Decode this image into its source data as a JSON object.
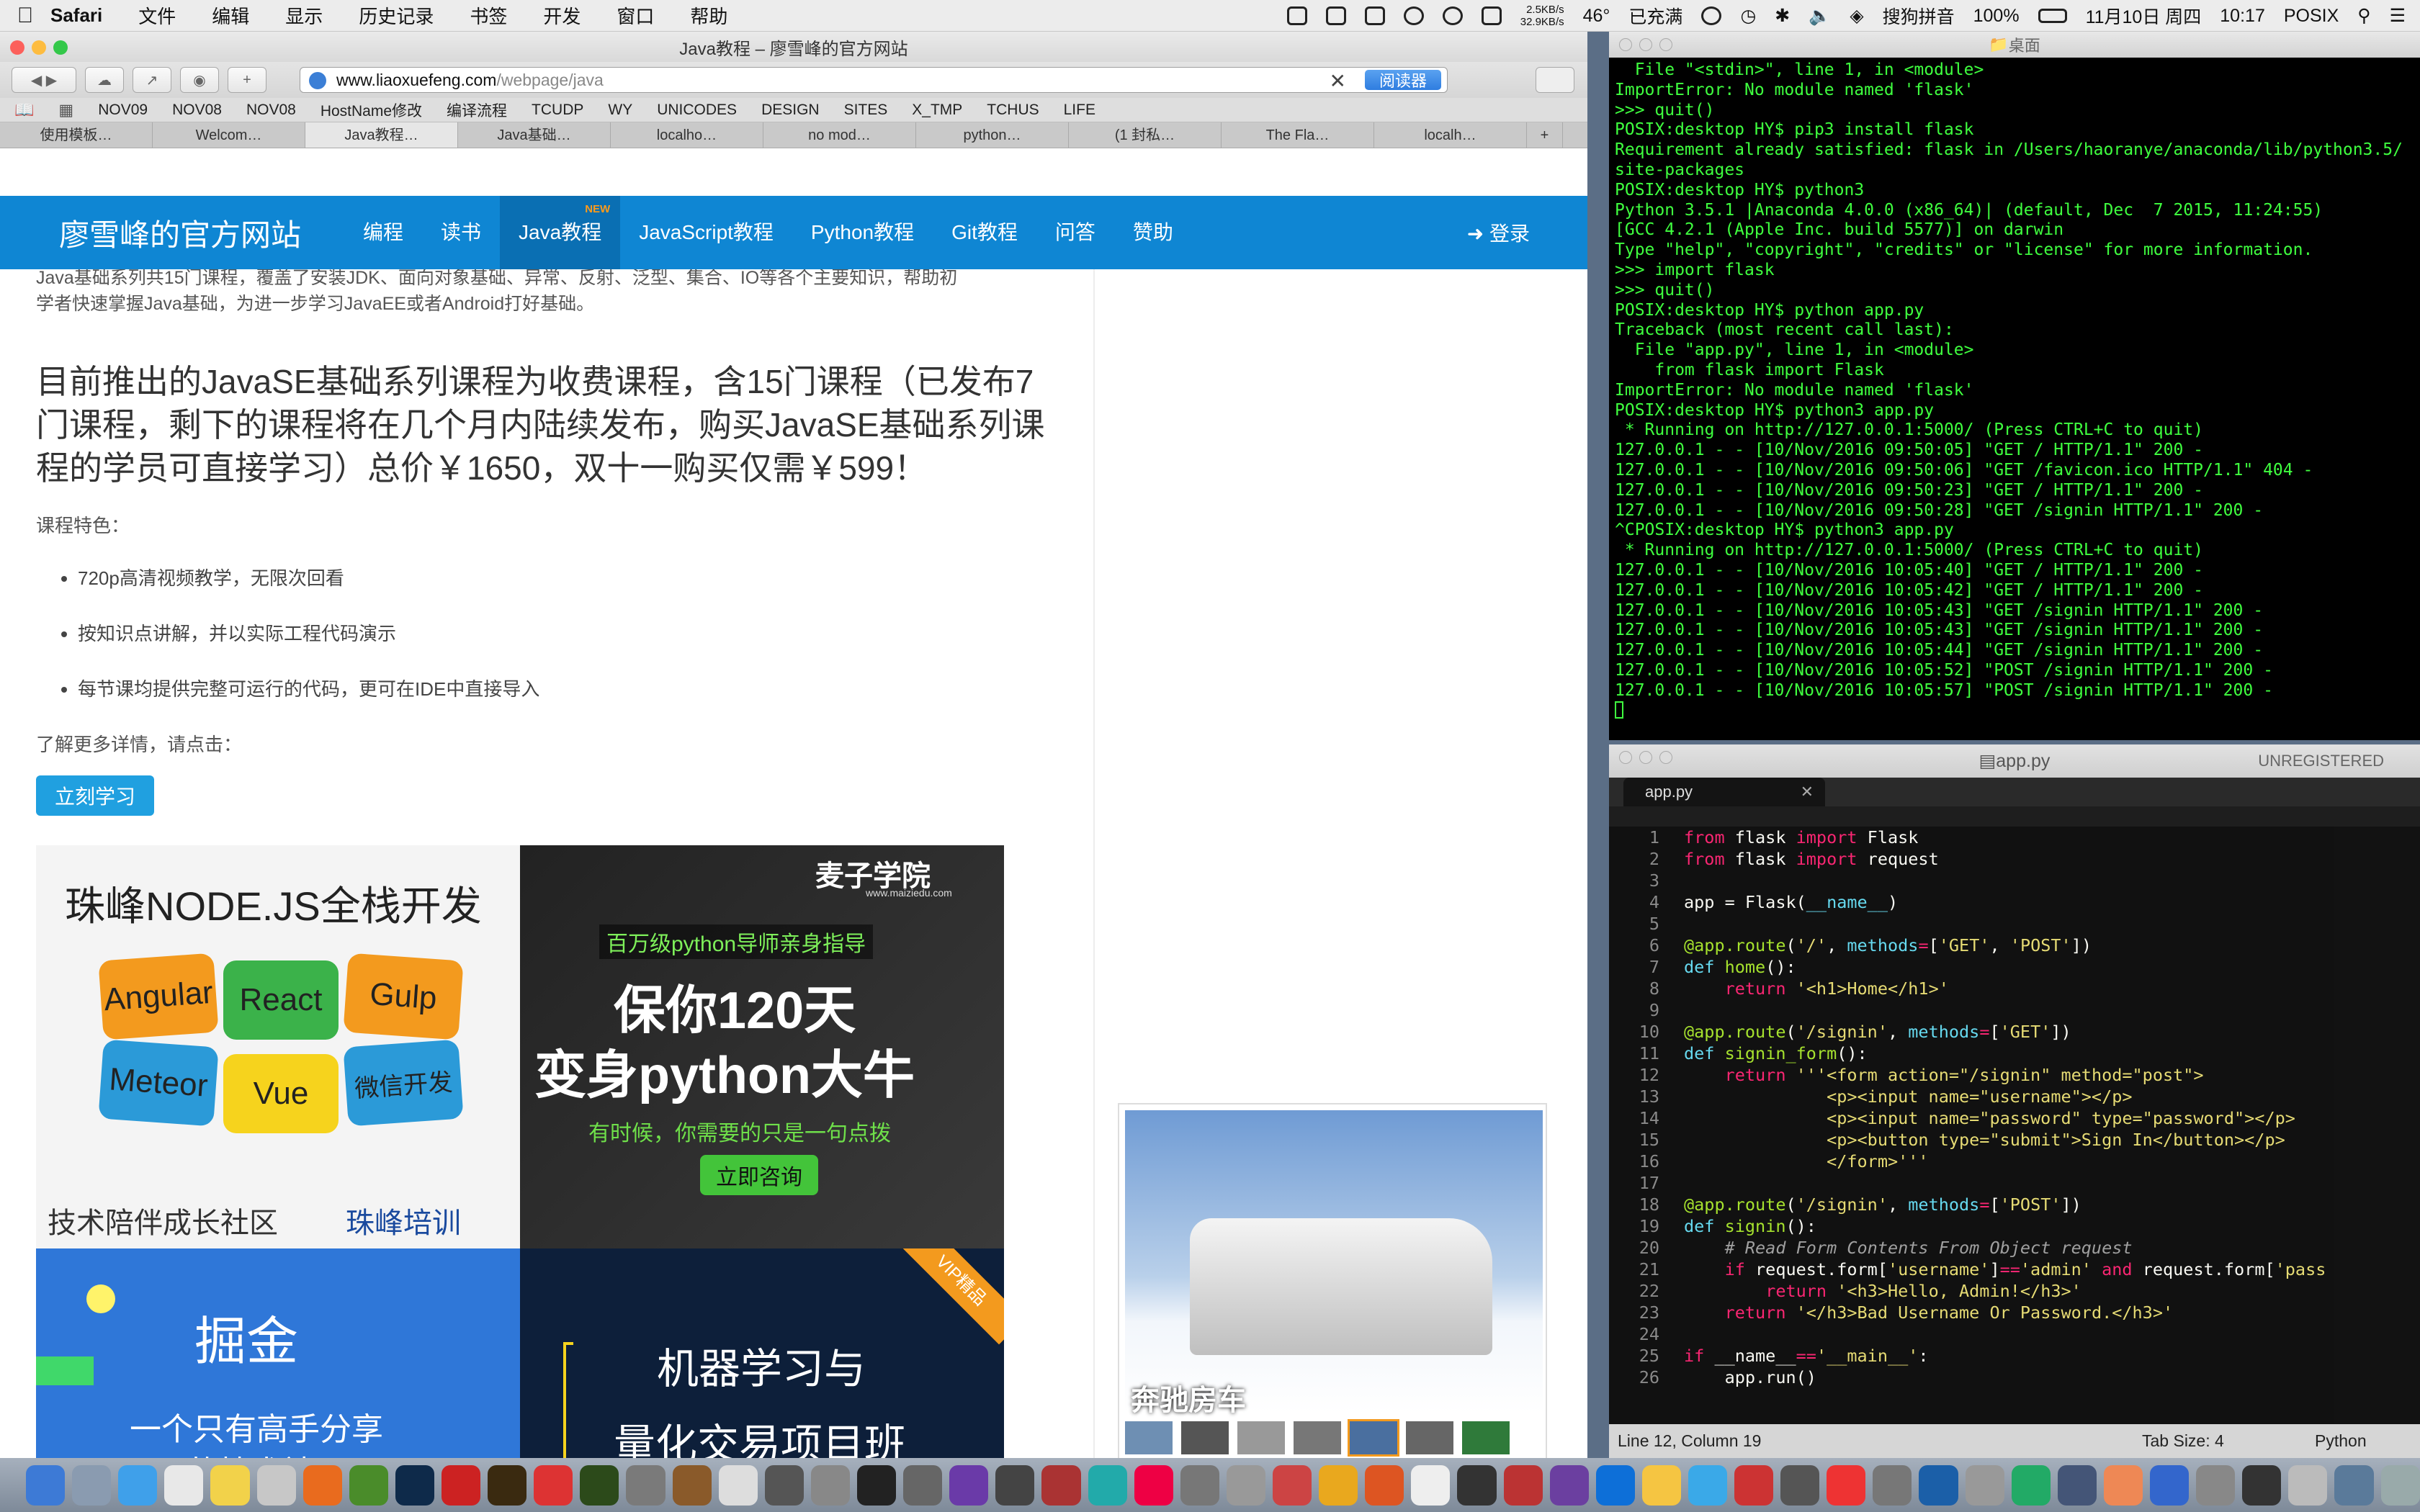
{
  "menubar": {
    "app": "Safari",
    "items": [
      "文件",
      "编辑",
      "显示",
      "历史记录",
      "书签",
      "开发",
      "窗口",
      "帮助"
    ],
    "net_up": "2.5KB/s",
    "net_down": "32.9KB/s",
    "temp": "46°",
    "charge": "已充满",
    "ime": "搜狗拼音",
    "battery": "100%",
    "date": "11月10日 周四",
    "time": "10:17",
    "user": "POSIX"
  },
  "safari": {
    "window_title": "Java教程 – 廖雪峰的官方网站",
    "url_host": "www.liaoxuefeng.com",
    "url_path": "/webpage/java",
    "reader_label": "阅读器",
    "bookmarks": [
      "NOV09",
      "NOV08",
      "NOV08",
      "HostName修改",
      "编译流程",
      "TCUDP",
      "WY",
      "UNICODES",
      "DESIGN",
      "SITES",
      "X_TMP",
      "TCHUS",
      "LIFE"
    ],
    "tabs": [
      "使用模板…",
      "Welcom…",
      "Java教程…",
      "Java基础…",
      "localho…",
      "no mod…",
      "python…",
      "(1 封私…",
      "The Fla…",
      "localh…"
    ]
  },
  "site": {
    "logo": "廖雪峰的官方网站",
    "nav": [
      "编程",
      "读书",
      "Java教程",
      "JavaScript教程",
      "Python教程",
      "Git教程",
      "问答",
      "赞助"
    ],
    "new_badge": "NEW",
    "login": "登录",
    "intro_line1": "Java基础系列共15门课程，覆盖了安装JDK、面向对象基础、异常、反射、泛型、集合、IO等各个主要知识，帮助初",
    "intro_line2": "学者快速掌握Java基础，为进一步学习JavaEE或者Android打好基础。",
    "headline": "目前推出的JavaSE基础系列课程为收费课程，含15门课程（已发布7门课程，剩下的课程将在几个月内陆续发布，购买JavaSE基础系列课程的学员可直接学习）总价￥1650，双十一购买仅需￥599！",
    "features_title": "课程特色：",
    "features": [
      "720p高清视频教学，无限次回看",
      "按知识点讲解，并以实际工程代码演示",
      "每节课均提供完整可运行的代码，更可在IDE中直接导入"
    ],
    "more": "了解更多详情，请点击：",
    "learn_button": "立刻学习",
    "ad1": {
      "title": "珠峰NODE.JS全栈开发",
      "tiles": [
        "Angular",
        "React",
        "Gulp",
        "Meteor",
        "Vue",
        "微信开发"
      ],
      "footer": "技术陪伴成长社区",
      "brand": "珠峰培训"
    },
    "ad2": {
      "brand": "麦子学院",
      "site": "www.maiziedu.com",
      "tag": "百万级python导师亲身指导",
      "line1": "保你120天",
      "line2": "变身python大牛",
      "sub": "有时候，你需要的只是一句点拨",
      "cta": "立即咨询"
    },
    "ad3": {
      "brand": "掘金",
      "sub1": "一个只有高手分享",
      "sub2": "的技术社区"
    },
    "ad4": {
      "badge": "VIP精品",
      "line1": "机器学习与",
      "line2": "量化交易项目班"
    },
    "ad_car": {
      "caption": "奔驰房车"
    }
  },
  "terminal": {
    "title": "桌面",
    "lines": [
      "  File \"<stdin>\", line 1, in <module>",
      "ImportError: No module named 'flask'",
      ">>> quit()",
      "POSIX:desktop HY$ pip3 install flask",
      "Requirement already satisfied: flask in /Users/haoranye/anaconda/lib/python3.5/",
      "site-packages",
      "POSIX:desktop HY$ python3",
      "Python 3.5.1 |Anaconda 4.0.0 (x86_64)| (default, Dec  7 2015, 11:24:55)",
      "[GCC 4.2.1 (Apple Inc. build 5577)] on darwin",
      "Type \"help\", \"copyright\", \"credits\" or \"license\" for more information.",
      ">>> import flask",
      ">>> quit()",
      "POSIX:desktop HY$ python app.py",
      "Traceback (most recent call last):",
      "  File \"app.py\", line 1, in <module>",
      "    from flask import Flask",
      "ImportError: No module named 'flask'",
      "POSIX:desktop HY$ python3 app.py",
      " * Running on http://127.0.0.1:5000/ (Press CTRL+C to quit)",
      "127.0.0.1 - - [10/Nov/2016 09:50:05] \"GET / HTTP/1.1\" 200 -",
      "127.0.0.1 - - [10/Nov/2016 09:50:06] \"GET /favicon.ico HTTP/1.1\" 404 -",
      "127.0.0.1 - - [10/Nov/2016 09:50:23] \"GET / HTTP/1.1\" 200 -",
      "127.0.0.1 - - [10/Nov/2016 09:50:28] \"GET /signin HTTP/1.1\" 200 -",
      "^CPOSIX:desktop HY$ python3 app.py",
      " * Running on http://127.0.0.1:5000/ (Press CTRL+C to quit)",
      "127.0.0.1 - - [10/Nov/2016 10:05:40] \"GET / HTTP/1.1\" 200 -",
      "127.0.0.1 - - [10/Nov/2016 10:05:42] \"GET / HTTP/1.1\" 200 -",
      "127.0.0.1 - - [10/Nov/2016 10:05:43] \"GET /signin HTTP/1.1\" 200 -",
      "127.0.0.1 - - [10/Nov/2016 10:05:43] \"GET /signin HTTP/1.1\" 200 -",
      "127.0.0.1 - - [10/Nov/2016 10:05:44] \"GET /signin HTTP/1.1\" 200 -",
      "127.0.0.1 - - [10/Nov/2016 10:05:52] \"POST /signin HTTP/1.1\" 200 -",
      "127.0.0.1 - - [10/Nov/2016 10:05:57] \"POST /signin HTTP/1.1\" 200 -"
    ]
  },
  "editor": {
    "title": "app.py",
    "unregistered": "UNREGISTERED",
    "tab": "app.py",
    "status_position": "Line 12, Column 19",
    "status_tabsize": "Tab Size: 4",
    "status_syntax": "Python"
  },
  "colors": {
    "site_nav": "#0f86d3",
    "terminal_text": "#3fff3f",
    "button": "#20a0e0"
  }
}
